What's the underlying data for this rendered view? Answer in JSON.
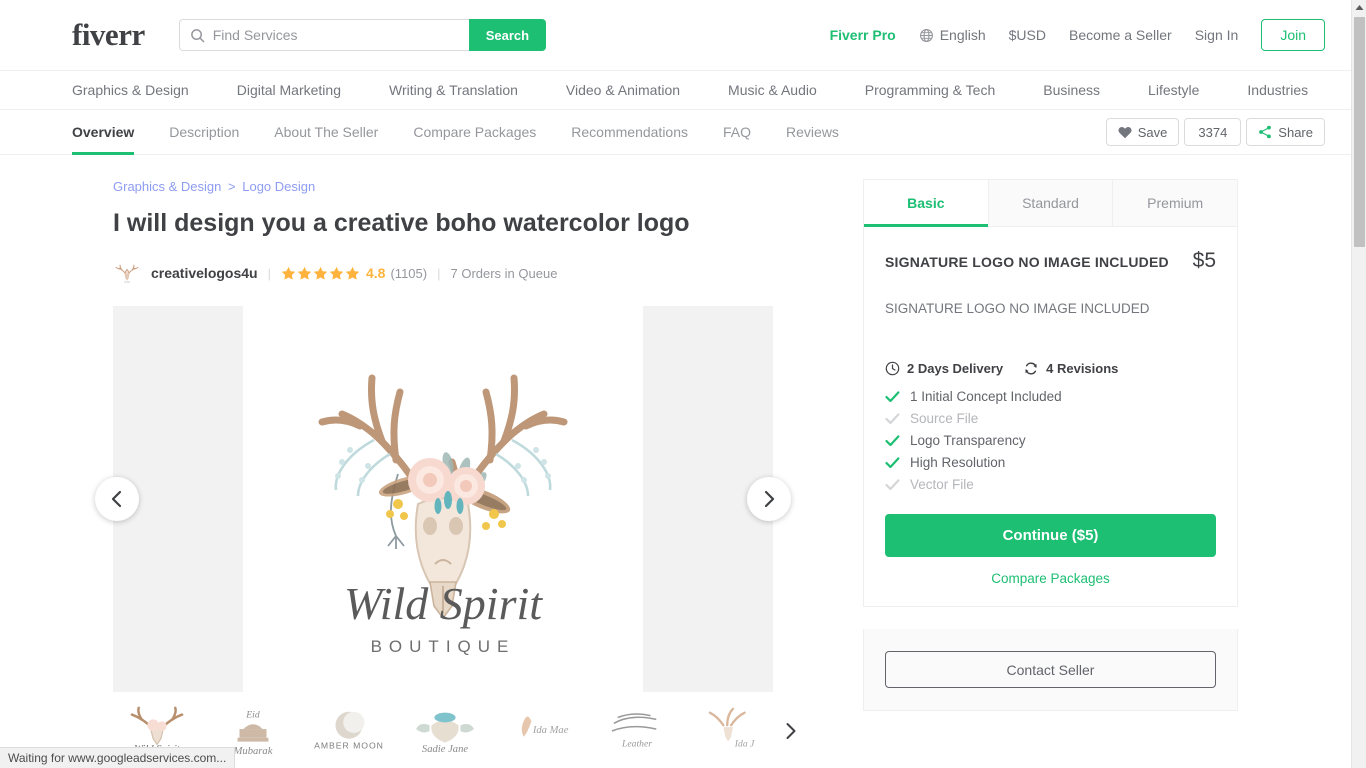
{
  "header": {
    "logo": "fiverr",
    "search": {
      "placeholder": "Find Services",
      "value": "",
      "button": "Search"
    },
    "links": [
      {
        "label": "Fiverr Pro",
        "style": "pro"
      },
      {
        "label": "English",
        "icon": "globe-icon"
      },
      {
        "label": "$USD"
      },
      {
        "label": "Become a Seller"
      },
      {
        "label": "Sign In"
      }
    ],
    "join": "Join"
  },
  "categories": [
    "Graphics & Design",
    "Digital Marketing",
    "Writing & Translation",
    "Video & Animation",
    "Music & Audio",
    "Programming & Tech",
    "Business",
    "Lifestyle",
    "Industries"
  ],
  "gig_tabs": {
    "items": [
      "Overview",
      "Description",
      "About The Seller",
      "Compare Packages",
      "Recommendations",
      "FAQ",
      "Reviews"
    ],
    "active": "Overview",
    "save_label": "Save",
    "save_count": "3374",
    "share_label": "Share"
  },
  "gig": {
    "breadcrumb": {
      "parent": "Graphics & Design",
      "separator": ">",
      "child": "Logo Design"
    },
    "title": "I will design you a creative boho watercolor logo",
    "seller": {
      "name": "creativelogos4u",
      "stars": 5,
      "rating": "4.8",
      "reviews": "(1105)",
      "queue": "7 Orders in Queue"
    },
    "gallery": {
      "prev_icon": "chevron-left-icon",
      "next_icon": "chevron-right-icon",
      "image_title": "Wild Spirit",
      "image_subtitle": "BOUTIQUE"
    },
    "thumbnails": [
      {
        "caption": "Wild Spirit"
      },
      {
        "caption": "Eid Mubarak"
      },
      {
        "caption": "AMBER MOON"
      },
      {
        "caption": "Sadie Jane"
      },
      {
        "caption": "Ida Mae"
      },
      {
        "caption": "Leather"
      },
      {
        "caption": "Ida J"
      }
    ]
  },
  "package": {
    "tabs": [
      "Basic",
      "Standard",
      "Premium"
    ],
    "active_tab": "Basic",
    "name": "SIGNATURE LOGO NO IMAGE INCLUDED",
    "price": "$5",
    "description": "SIGNATURE LOGO NO IMAGE INCLUDED",
    "delivery": "2 Days Delivery",
    "revisions": "4 Revisions",
    "features": [
      {
        "label": "1 Initial Concept Included",
        "included": true
      },
      {
        "label": "Source File",
        "included": false
      },
      {
        "label": "Logo Transparency",
        "included": true
      },
      {
        "label": "High Resolution",
        "included": true
      },
      {
        "label": "Vector File",
        "included": false
      }
    ],
    "continue_label": "Continue ($5)",
    "compare_label": "Compare Packages",
    "contact_label": "Contact Seller"
  },
  "browser": {
    "status": "Waiting for www.googleadservices.com..."
  },
  "colors": {
    "brand_green": "#1dbf73",
    "star_gold": "#ffb33e",
    "text_dark": "#404145",
    "text_muted": "#74767e",
    "link_blue": "#8e9cf2"
  }
}
